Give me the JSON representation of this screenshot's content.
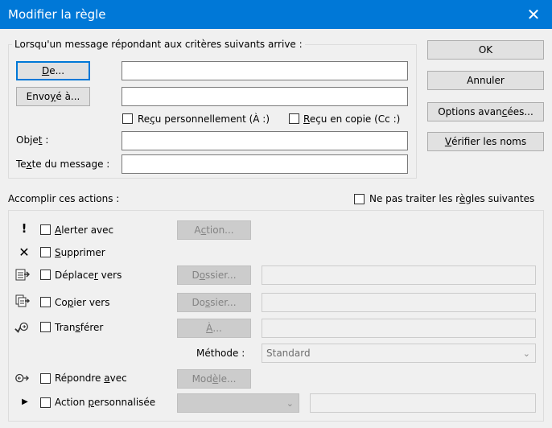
{
  "window": {
    "title": "Modifier la règle"
  },
  "conditions": {
    "legend": "Lorsqu'un message répondant aux critères suivants arrive :",
    "from_btn": {
      "pre": "",
      "u": "D",
      "post": "e..."
    },
    "sentto_btn": {
      "pre": "Envo",
      "u": "y",
      "post": "é à..."
    },
    "cb_personal": {
      "pre": "Re",
      "u": "ç",
      "post": "u personnellement (À :)"
    },
    "cb_cc": {
      "pre": "",
      "u": "R",
      "post": "eçu en copie (Cc :)"
    },
    "subject": {
      "pre": "Obje",
      "u": "t",
      "post": " :"
    },
    "body": {
      "pre": "Te",
      "u": "x",
      "post": "te du message :"
    }
  },
  "buttons": {
    "ok": "OK",
    "cancel": "Annuler",
    "advanced": {
      "pre": "Options avan",
      "u": "c",
      "post": "ées..."
    },
    "checknames": {
      "pre": "",
      "u": "V",
      "post": "érifier les noms"
    }
  },
  "actions": {
    "header": "Accomplir ces actions :",
    "no_more_rules": {
      "pre": "Ne pas traiter les r",
      "u": "è",
      "post": "gles suivantes"
    },
    "alert": {
      "pre": "",
      "u": "A",
      "post": "lerter avec",
      "btn": {
        "pre": "A",
        "u": "c",
        "post": "tion..."
      }
    },
    "delete": {
      "pre": "",
      "u": "S",
      "post": "upprimer"
    },
    "move": {
      "pre": "Déplace",
      "u": "r",
      "post": " vers",
      "btn": {
        "pre": "D",
        "u": "o",
        "post": "ssier..."
      }
    },
    "copy": {
      "pre": "Co",
      "u": "p",
      "post": "ier vers",
      "btn": {
        "pre": "Do",
        "u": "s",
        "post": "sier..."
      }
    },
    "forward": {
      "pre": "Tran",
      "u": "s",
      "post": "férer",
      "btn": {
        "pre": "",
        "u": "À",
        "post": "..."
      }
    },
    "method_label": "Méthode :",
    "method_value": "Standard",
    "reply": {
      "pre": "Répondre ",
      "u": "a",
      "post": "vec",
      "btn": {
        "pre": "Mod",
        "u": "è",
        "post": "le..."
      }
    },
    "custom": {
      "pre": "Action ",
      "u": "p",
      "post": "ersonnalisée"
    }
  },
  "icons": {
    "close": "close-icon",
    "alert": "exclamation-icon",
    "delete": "x-delete-icon",
    "move": "move-folder-icon",
    "copy": "copy-folder-icon",
    "forward": "forward-icon",
    "reply": "reply-icon",
    "custom": "play-arrow-icon"
  },
  "colors": {
    "title_bar": "#0078d7",
    "accent": "#0078d7"
  }
}
